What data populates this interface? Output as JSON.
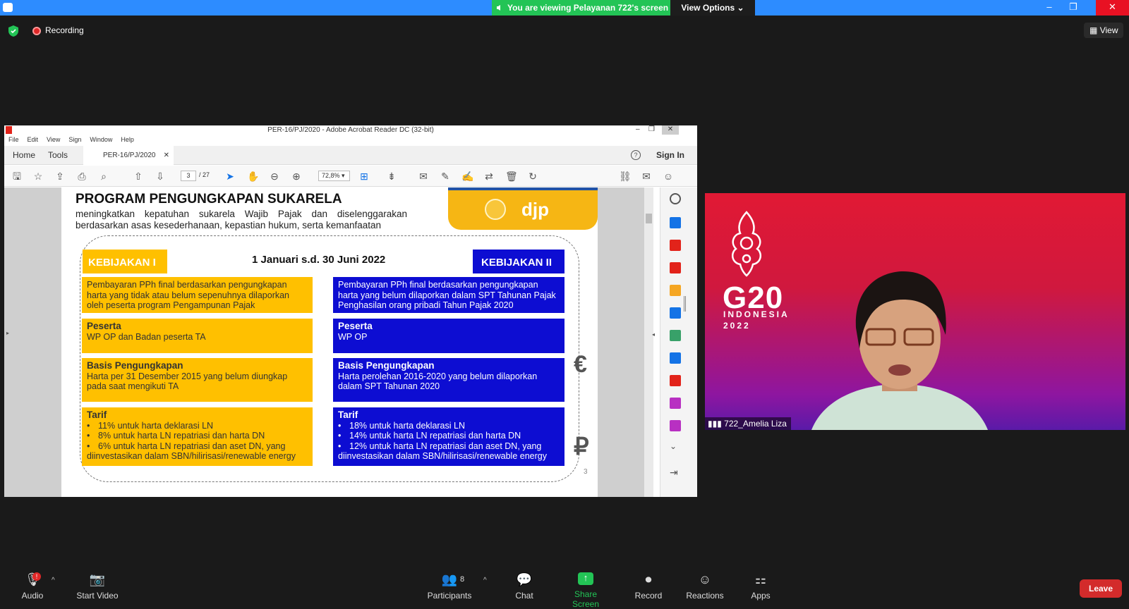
{
  "zoom": {
    "viewing_banner": "You are viewing Pelayanan 722's screen",
    "view_options": "View Options",
    "recording_label": "Recording",
    "view_button": "View",
    "participants_count": "8",
    "bottom_bar": {
      "audio": "Audio",
      "start_video": "Start Video",
      "participants": "Participants",
      "chat": "Chat",
      "share_screen": "Share Screen",
      "record": "Record",
      "reactions": "Reactions",
      "apps": "Apps",
      "leave": "Leave"
    },
    "video": {
      "name": "722_Amelia Liza",
      "g20": "G20",
      "country": "INDONESIA",
      "year": "2022"
    },
    "accent": "#2d8cff",
    "leave_color": "#d32b2b"
  },
  "acrobat": {
    "window_title": "PER-16/PJ/2020 - Adobe Acrobat Reader DC (32-bit)",
    "menu": [
      "File",
      "Edit",
      "View",
      "Sign",
      "Window",
      "Help"
    ],
    "tabs": {
      "home": "Home",
      "tools": "Tools",
      "doc": "PER-16/PJ/2020"
    },
    "sign_in": "Sign In",
    "page_current": "3",
    "page_total": "/ 27",
    "zoom_level": "72,8%"
  },
  "slide": {
    "title": "PROGRAM PENGUNGKAPAN SUKARELA",
    "subtitle": "meningkatkan kepatuhan sukarela Wajib Pajak dan diselenggarakan berdasarkan asas kesederhanaan, kepastian hukum, serta kemanfaatan",
    "logo_text": "djp",
    "date": "1 Januari s.d. 30 Juni 2022",
    "page_number": "3",
    "k1": {
      "heading": "KEBIJAKAN I",
      "desc": "Pembayaran PPh final berdasarkan pengungkapan harta yang tidak atau belum sepenuhnya dilaporkan oleh peserta program Pengampunan Pajak",
      "peserta_title": "Peserta",
      "peserta_text": "WP OP dan Badan peserta TA",
      "basis_title": "Basis Pengungkapan",
      "basis_text": "Harta per 31 Desember 2015 yang belum diungkap pada saat mengikuti TA",
      "tarif_title": "Tarif",
      "tarif_items": [
        "11% untuk harta deklarasi LN",
        "8% untuk harta LN repatriasi dan harta DN",
        "6% untuk harta LN repatriasi dan aset DN, yang diinvestasikan dalam SBN/hilirisasi/renewable energy"
      ]
    },
    "k2": {
      "heading": "KEBIJAKAN II",
      "desc": "Pembayaran PPh final berdasarkan pengungkapan harta yang belum dilaporkan dalam SPT Tahunan Pajak Penghasilan orang pribadi Tahun Pajak 2020",
      "peserta_title": "Peserta",
      "peserta_text": "WP OP",
      "basis_title": "Basis Pengungkapan",
      "basis_text": "Harta perolehan 2016-2020 yang belum dilaporkan dalam SPT Tahunan 2020",
      "tarif_title": "Tarif",
      "tarif_items": [
        "18% untuk harta deklarasi LN",
        "14% untuk harta LN repatriasi dan harta DN",
        "12% untuk harta LN repatriasi dan aset DN, yang diinvestasikan dalam SBN/hilirisasi/renewable energy"
      ]
    }
  }
}
